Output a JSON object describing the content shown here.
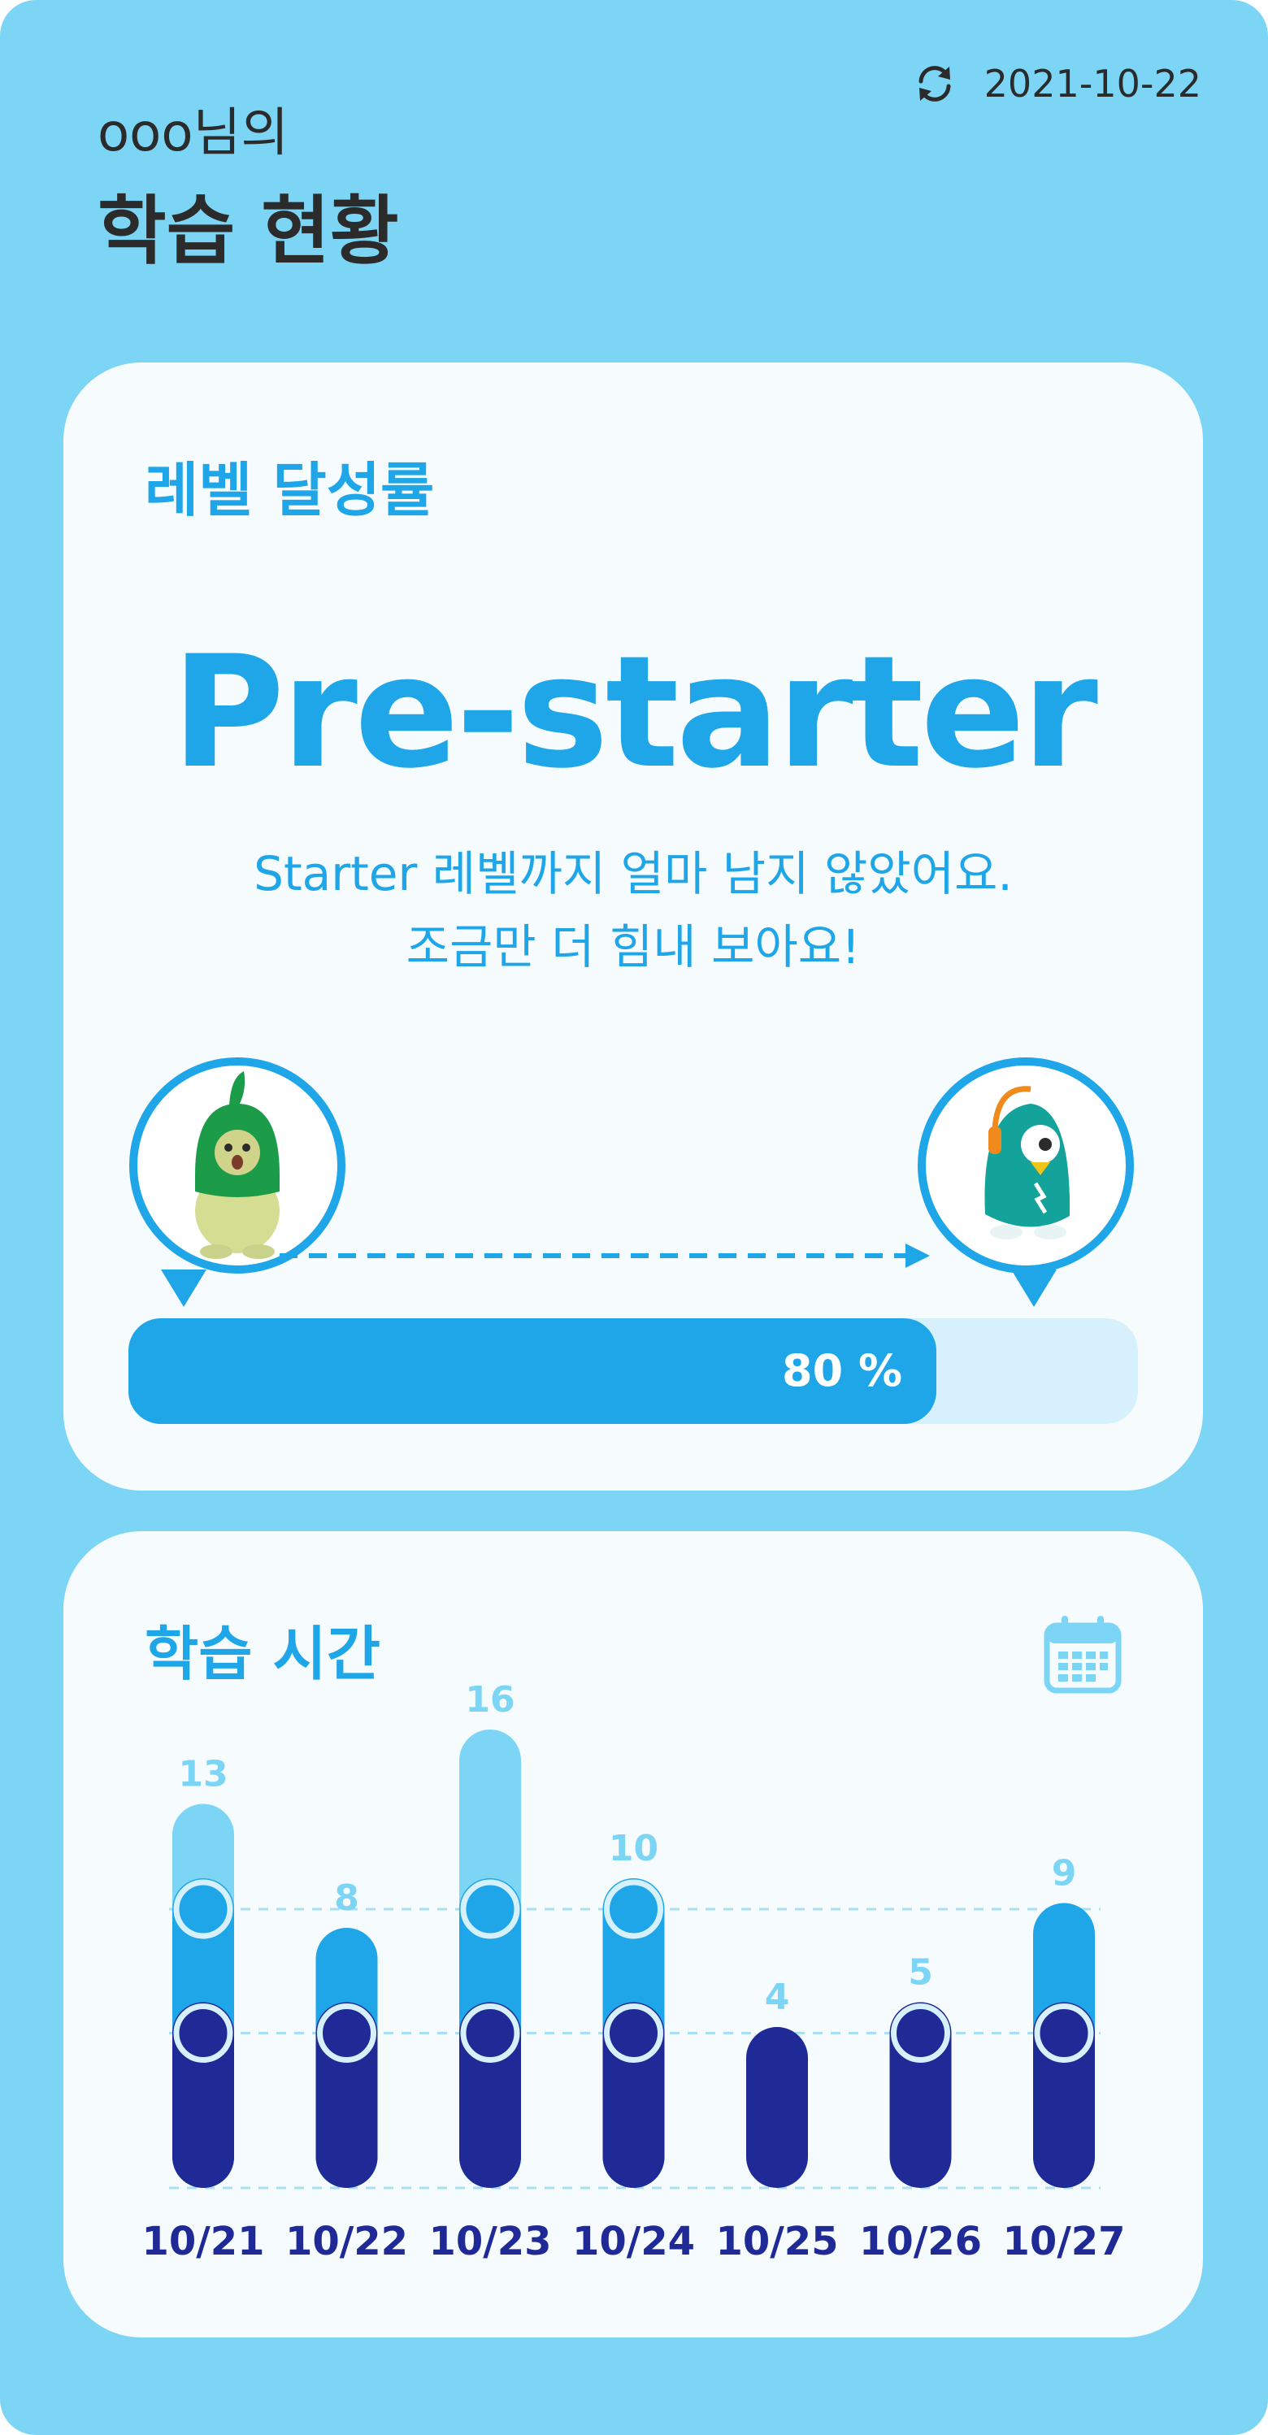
{
  "header": {
    "user_greeting": "ooo님의",
    "title": "학습 현황",
    "date": "2021-10-22"
  },
  "icons": [
    "refresh-icon",
    "calendar-icon",
    "level-character-start",
    "level-character-goal",
    "arrow-right-icon"
  ],
  "level_card": {
    "title": "레벨 달성률",
    "level_name": "Pre-starter",
    "message_line1": "Starter 레벨까지 얼마 남지 않았어요.",
    "message_line2": "조금만 더 힘내 보아요!",
    "progress_value": 80,
    "progress_label": "80 %"
  },
  "time_card": {
    "title": "학습 시간"
  },
  "colors": {
    "background": "#7dd5f5",
    "card": "#f6fbfe",
    "accent": "#1ea6e8",
    "light_segment": "#7dd5f5",
    "dark_segment": "#1f2a96",
    "track": "#d6f1fb"
  },
  "chart_data": {
    "type": "bar",
    "stacked": true,
    "categories": [
      "10/21",
      "10/22",
      "10/23",
      "10/24",
      "10/25",
      "10/26",
      "10/27"
    ],
    "values": [
      13,
      8,
      16,
      10,
      4,
      5,
      9
    ],
    "segment_thresholds": [
      5,
      10
    ],
    "ylim": [
      0,
      16
    ],
    "grid": "dashed at thresholds"
  }
}
